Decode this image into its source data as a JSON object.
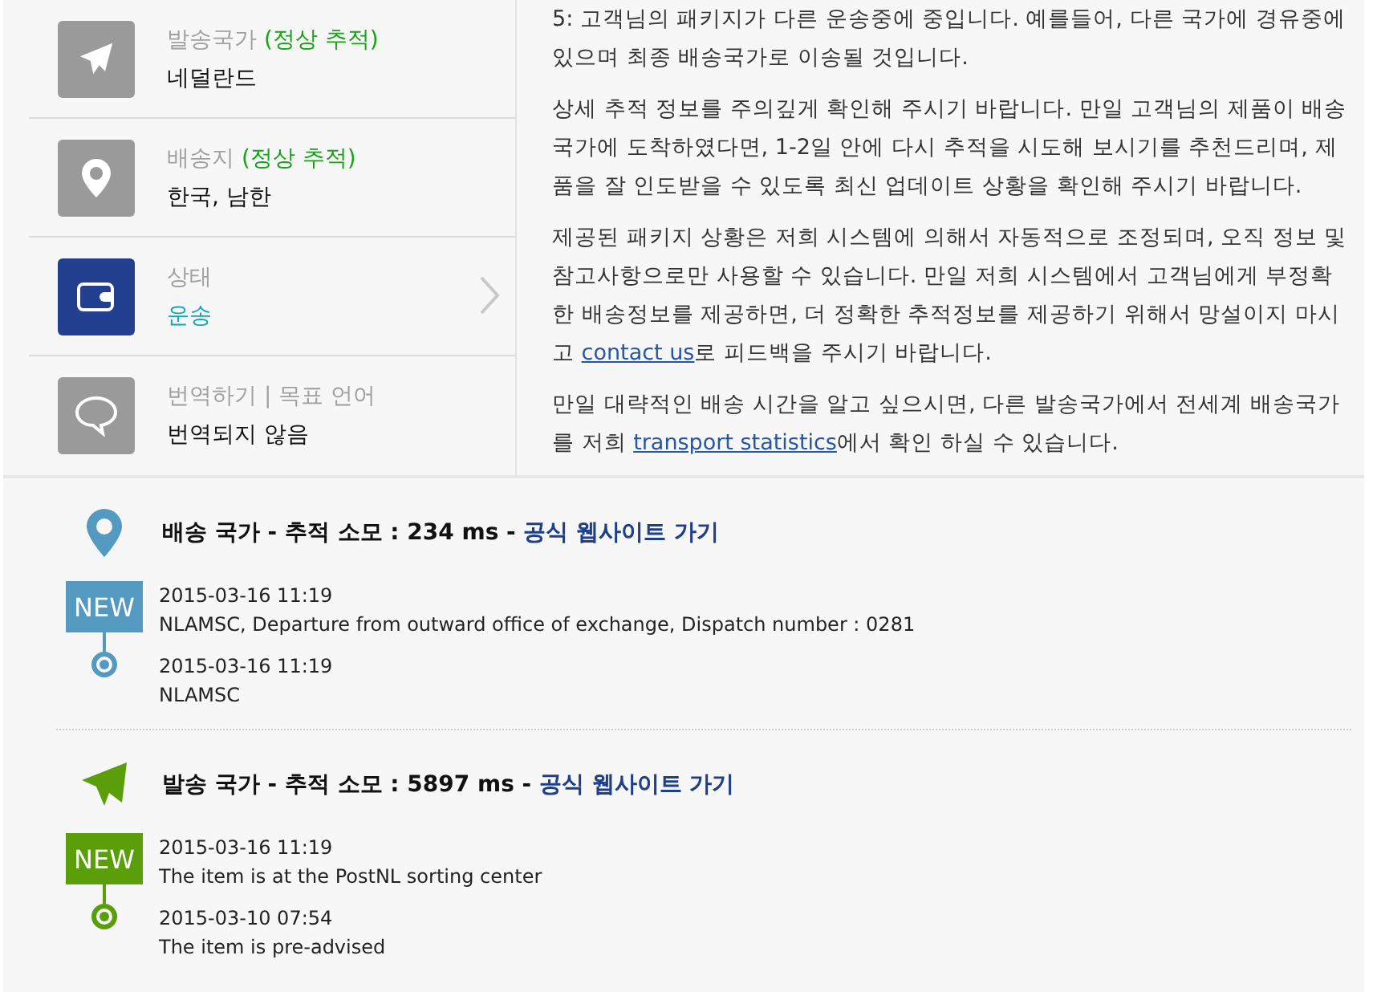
{
  "info_rows": [
    {
      "kind": "plane",
      "label": "발송국가",
      "status": "(정상 추적)",
      "value": "네덜란드",
      "selected": false
    },
    {
      "kind": "pin",
      "label": "배송지",
      "status": "(정상 추적)",
      "value": "한국, 남한",
      "selected": false
    },
    {
      "kind": "wallet",
      "label": "상태",
      "value": "운송",
      "selected": true
    },
    {
      "kind": "chat",
      "label": "번역하기 | 목표 언어",
      "value": "번역되지 않음",
      "selected": false
    }
  ],
  "paragraphs": [
    [
      {
        "text": "5: 고객님의 패키지가 다른 운송중에 중입니다. 예를들어, 다른 국가에 경유중에 있으며 최종 배송국가로 이송될 것입니다."
      }
    ],
    [
      {
        "text": "상세 추적 정보를 주의깊게 확인해 주시기 바랍니다. 만일 고객님의 제품이 배송국가에 도착하였다면, 1-2일 안에 다시 추적을 시도해 보시기를 추천드리며, 제품을 잘 인도받을 수 있도록 최신 업데이트 상황을 확인해 주시기 바랍니다."
      }
    ],
    [
      {
        "text": "제공된 패키지 상황은 저희 시스템에 의해서 자동적으로 조정되며, 오직 정보 및 참고사항으로만 사용할 수 있습니다. 만일 저희 시스템에서 고객님에게 부정확한 배송정보를 제공하면, 더 정확한 추적정보를 제공하기 위해서 망설이지 마시고 "
      },
      {
        "link": "contact us"
      },
      {
        "text": "로 피드백을 주시기 바랍니다."
      }
    ],
    [
      {
        "text": "만일 대략적인 배송 시간을 알고 싶으시면, 다른 발송국가에서 전세계 배송국가를 저희 "
      },
      {
        "link": "transport statistics"
      },
      {
        "text": "에서 확인 하실 수 있습니다."
      }
    ]
  ],
  "tracking": [
    {
      "kind": "destination",
      "heading": "배송 국가 - 추적 소모 : 234 ms -",
      "link": "공식 웹사이트 가기",
      "events": [
        {
          "badge": "NEW",
          "date": "2015-03-16 11:19",
          "description": "NLAMSC, Departure from outward office of exchange, Dispatch number : 0281"
        },
        {
          "date": "2015-03-16 11:19",
          "description": "NLAMSC"
        }
      ]
    },
    {
      "kind": "origin",
      "heading": "발송 국가 - 추적 소모 : 5897 ms -",
      "link": "공식 웹사이트 가기",
      "events": [
        {
          "badge": "NEW",
          "date": "2015-03-16 11:19",
          "description": "The item is at the PostNL sorting center"
        },
        {
          "date": "2015-03-10 07:54",
          "description": "The item is pre-advised"
        }
      ]
    }
  ]
}
